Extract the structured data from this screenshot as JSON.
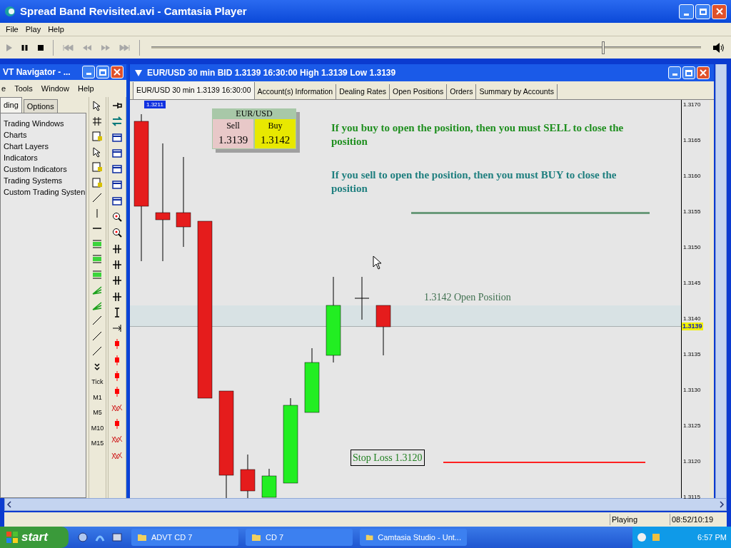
{
  "player": {
    "title": "Spread Band Revisited.avi - Camtasia Player",
    "menu": [
      "File",
      "Play",
      "Help"
    ],
    "seek": {
      "level": 0.82
    },
    "status": "Playing",
    "time": "08:52/10:19"
  },
  "navigator": {
    "title": "VT Navigator - ...",
    "menu": [
      "e",
      "Tools",
      "Window",
      "Help"
    ],
    "tabs": [
      {
        "label": "ding",
        "selected": true
      },
      {
        "label": "Options",
        "selected": false
      }
    ],
    "items": [
      "Trading Windows",
      "Charts",
      "Chart Layers",
      "Indicators",
      "Custom Indicators",
      "Trading Systems",
      "Custom Trading Systen"
    ],
    "periods": [
      "Tick",
      "M1",
      "M5",
      "M10",
      "M15"
    ]
  },
  "chart_window": {
    "title": "EUR/USD 30 min BID 1.3139 16:30:00 High 1.3139 Low 1.3139",
    "tabs": [
      {
        "label": "EUR/USD 30 min 1.3139 16:30:00",
        "selected": true
      },
      {
        "label": "Account(s) Information",
        "selected": false
      },
      {
        "label": "Dealing Rates",
        "selected": false
      },
      {
        "label": "Open Positions",
        "selected": false
      },
      {
        "label": "Orders",
        "selected": false
      },
      {
        "label": "Summary by Accounts",
        "selected": false
      }
    ],
    "marker": "1.3211",
    "quote": {
      "symbol": "EUR/USD",
      "sell_label": "Sell",
      "sell_value": "1.3139",
      "buy_label": "Buy",
      "buy_value": "1.3142"
    },
    "notes": [
      {
        "text": "If you buy to open the position, then you must SELL to close the position",
        "color": "#1f8f1f"
      },
      {
        "text": "If you sell to open the position, then you must BUY to close the position",
        "color": "#1f7f7f"
      }
    ],
    "open_position": "1.3142 Open Position",
    "stop_loss": "Stop Loss 1.3120",
    "price_axis": [
      "1.3170",
      "1.3165",
      "1.3160",
      "1.3155",
      "1.3150",
      "1.3145",
      "1.3140",
      "1.3135",
      "1.3130",
      "1.3125",
      "1.3120",
      "1.3115"
    ],
    "current_price": "1.3139"
  },
  "taskbar": {
    "start": "start",
    "tasks": [
      {
        "label": "ADVT CD 7",
        "selected": false
      },
      {
        "label": "CD 7",
        "selected": false
      },
      {
        "label": "Camtasia Studio - Unt...",
        "selected": false
      }
    ],
    "clock": "6:57 PM"
  }
}
